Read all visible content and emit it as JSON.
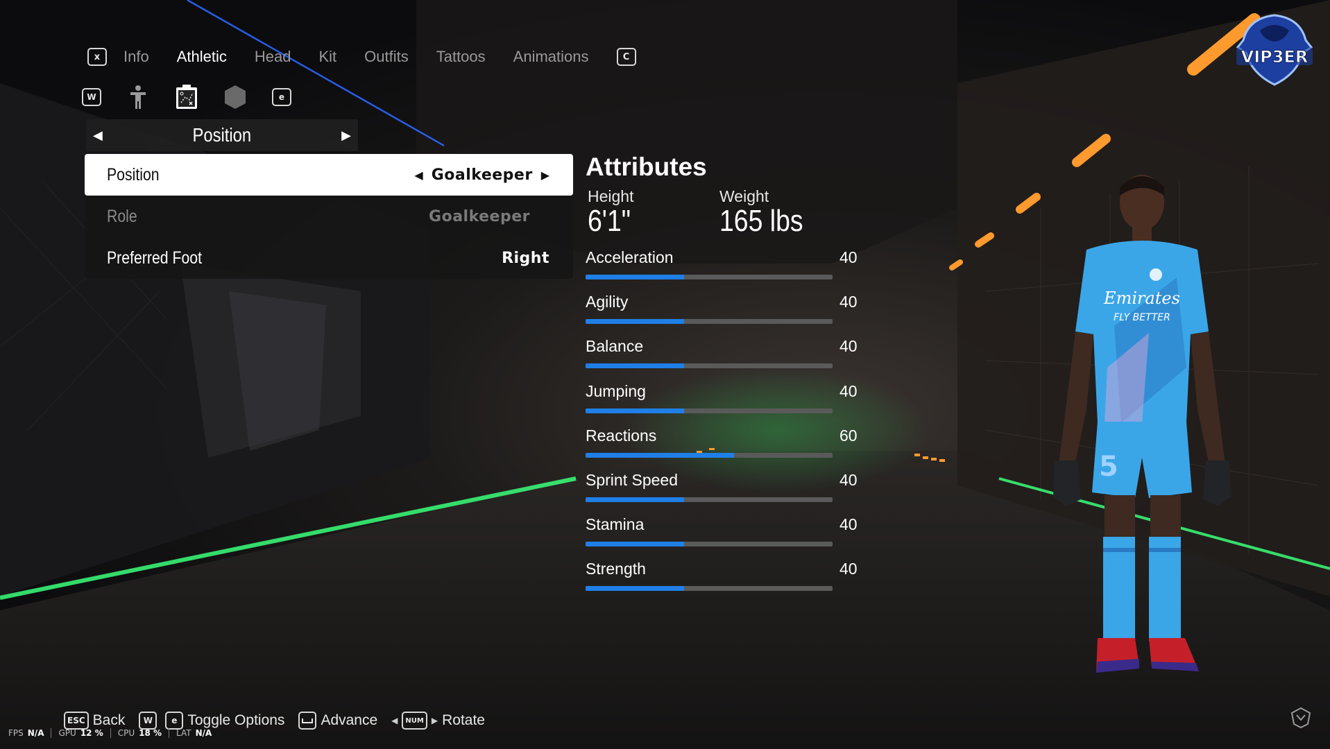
{
  "tabs": {
    "prev_key": "x",
    "next_key": "C",
    "items": [
      {
        "label": "Info",
        "active": false
      },
      {
        "label": "Athletic",
        "active": true
      },
      {
        "label": "Head",
        "active": false
      },
      {
        "label": "Kit",
        "active": false
      },
      {
        "label": "Outfits",
        "active": false
      },
      {
        "label": "Tattoos",
        "active": false
      },
      {
        "label": "Animations",
        "active": false
      }
    ]
  },
  "subicons": {
    "prev_key": "W",
    "next_key": "e",
    "icons": [
      "body-icon",
      "tactics-board-icon",
      "hexagon-icon"
    ]
  },
  "selector": {
    "title": "Position",
    "left_arrow": "◀",
    "right_arrow": "▶"
  },
  "settings": {
    "position": {
      "label": "Position",
      "value": "Goalkeeper"
    },
    "role": {
      "label": "Role",
      "value": "Goalkeeper"
    },
    "foot": {
      "label": "Preferred Foot",
      "value": "Right"
    }
  },
  "attributes": {
    "title": "Attributes",
    "height_label": "Height",
    "height_value": "6'1\"",
    "weight_label": "Weight",
    "weight_value": "165 lbs",
    "max": 100,
    "stats": [
      {
        "name": "Acceleration",
        "value": 40
      },
      {
        "name": "Agility",
        "value": 40
      },
      {
        "name": "Balance",
        "value": 40
      },
      {
        "name": "Jumping",
        "value": 40
      },
      {
        "name": "Reactions",
        "value": 60
      },
      {
        "name": "Sprint Speed",
        "value": 40
      },
      {
        "name": "Stamina",
        "value": 40
      },
      {
        "name": "Strength",
        "value": 40
      }
    ]
  },
  "logo": {
    "text": "VIP3ER"
  },
  "hints": {
    "back_key": "ESC",
    "back_label": "Back",
    "toggle_key1": "W",
    "toggle_key2": "e",
    "toggle_label": "Toggle Options",
    "advance_label": "Advance",
    "rotate_key": "NUM",
    "rotate_label": "Rotate"
  },
  "perf": {
    "fps_label": "FPS",
    "fps_value": "N/A",
    "gpu_label": "GPU",
    "gpu_value": "12 %",
    "cpu_label": "CPU",
    "cpu_value": "18 %",
    "lat_label": "LAT",
    "lat_value": "N/A"
  },
  "colors": {
    "accent_bar": "#1f7fe6",
    "track": "#5a5a5a",
    "neon_green": "#3bff7a",
    "neon_orange": "#ff9a2e",
    "kit_blue": "#3aa6e8"
  }
}
